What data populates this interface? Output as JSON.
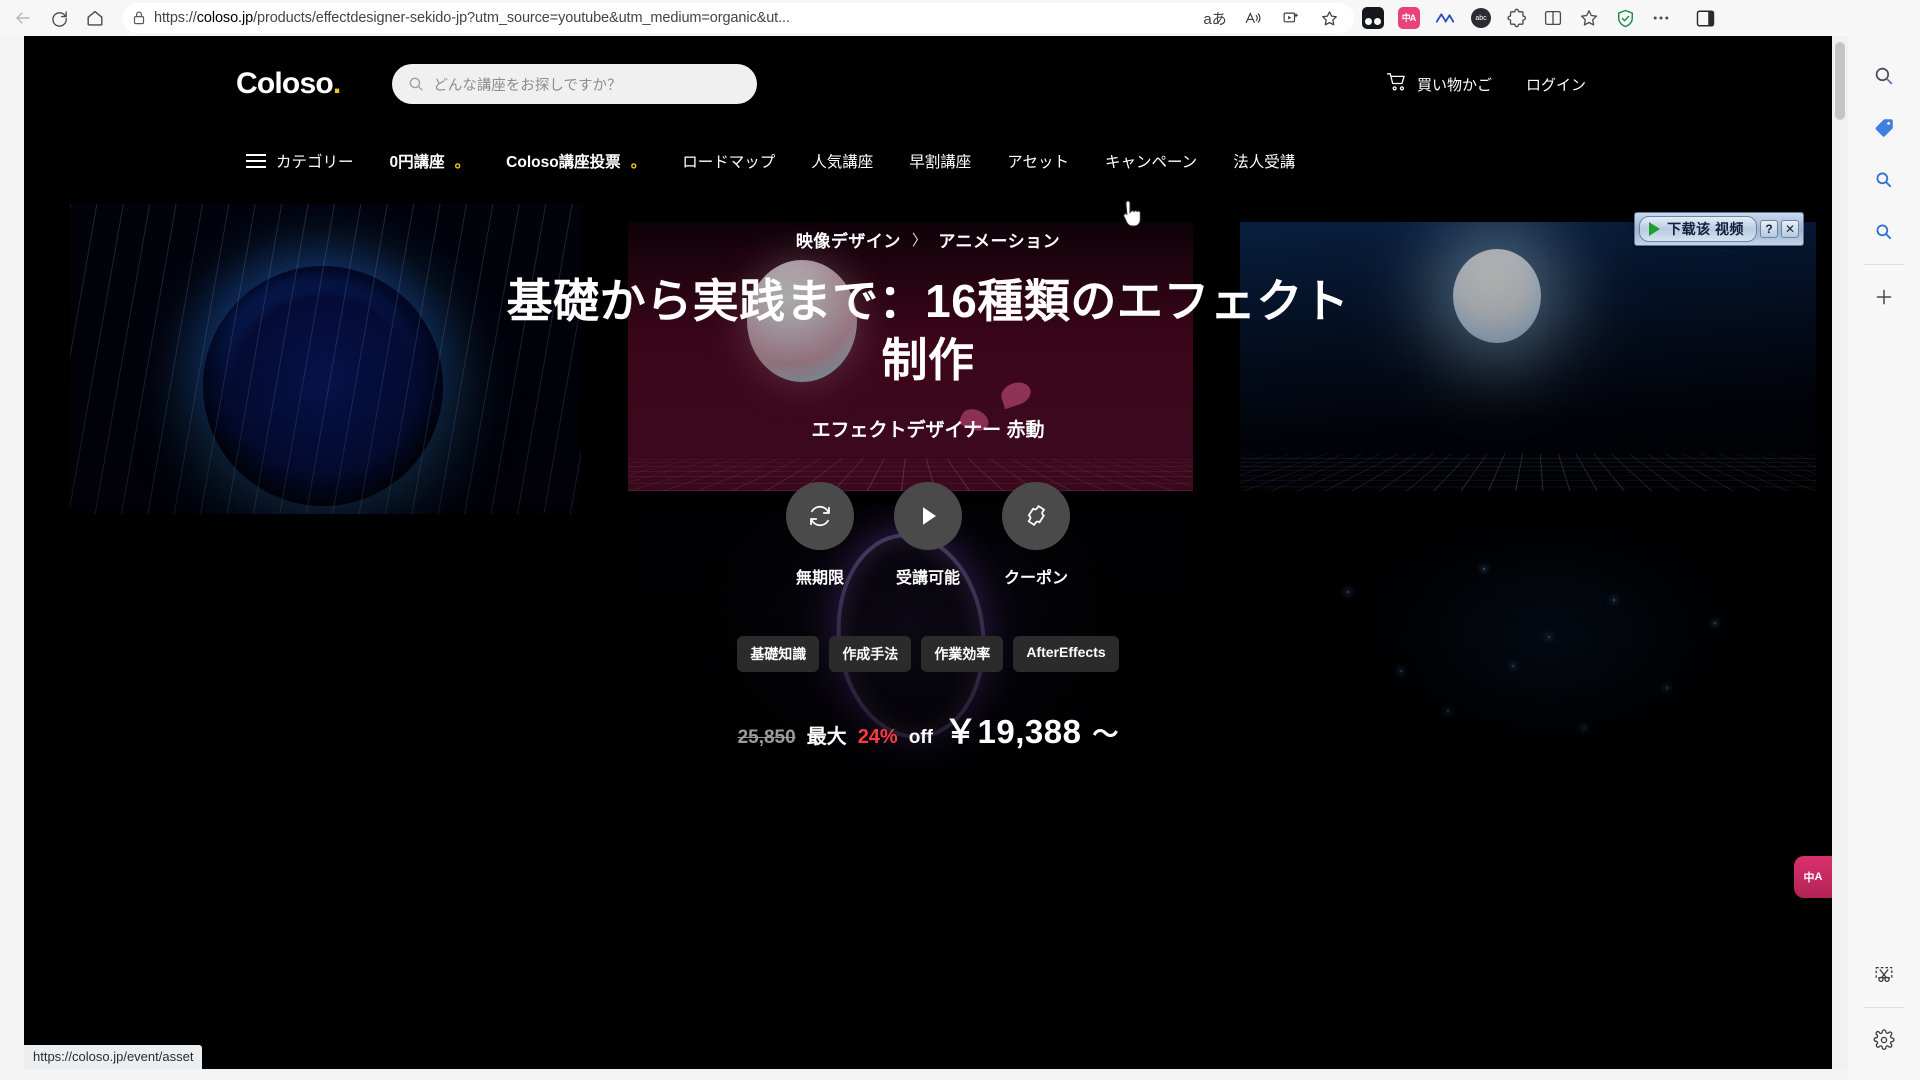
{
  "browser": {
    "back_label": "Back",
    "refresh_label": "Refresh",
    "home_label": "Home",
    "url_host": "coloso.jp",
    "url_prefix": "https://",
    "url_rest": "/products/effectdesigner-sekido-jp?utm_source=youtube&utm_medium=organic&ut...",
    "reading_icon": "aあ",
    "read_aloud_icon": "read-aloud",
    "split_icon": "split-screen",
    "favorite_icon": "star",
    "extensions": [
      {
        "name": "immersive-reader-extension",
        "label": ""
      },
      {
        "name": "translate-extension",
        "label_cn": "中",
        "label_a": "A"
      },
      {
        "name": "claude-extension",
        "label": ""
      },
      {
        "name": "dark-reader-extension",
        "label": ""
      },
      {
        "name": "puzzle-extension",
        "label": ""
      }
    ],
    "collections_label": "Collections",
    "favorites_label": "Favorites",
    "shield_label": "Tracking prevention",
    "more_label": "Settings and more",
    "split_pane_label": "Split screen",
    "status_url": "https://coloso.jp/event/asset"
  },
  "edge_sidebar": {
    "items": [
      {
        "name": "search-icon-1",
        "label": "Search"
      },
      {
        "name": "shopping-tag-icon",
        "label": "Shopping"
      },
      {
        "name": "search-icon-2",
        "label": "Search"
      },
      {
        "name": "search-icon-3",
        "label": "Search"
      },
      {
        "name": "add-icon",
        "label": "Add"
      },
      {
        "name": "screenshot-icon",
        "label": "Web capture"
      },
      {
        "name": "settings-icon",
        "label": "Settings"
      }
    ]
  },
  "site": {
    "logo_text": "Coloso",
    "logo_dot": ".",
    "logo_dot_color": "#f5c518",
    "search_placeholder": "どんな講座をお探しですか？",
    "cart_label": "買い物かご",
    "login_label": "ログイン",
    "nav": [
      {
        "label": "カテゴリー",
        "bold": false,
        "dot": ""
      },
      {
        "label": "0円講座",
        "bold": true,
        "dot": "。"
      },
      {
        "label": "Coloso講座投票",
        "bold": true,
        "dot": "。"
      },
      {
        "label": "ロードマップ",
        "bold": false,
        "dot": ""
      },
      {
        "label": "人気講座",
        "bold": false,
        "dot": ""
      },
      {
        "label": "早割講座",
        "bold": false,
        "dot": ""
      },
      {
        "label": "アセット",
        "bold": false,
        "dot": ""
      },
      {
        "label": "キャンペーン",
        "bold": false,
        "dot": ""
      },
      {
        "label": "法人受講",
        "bold": false,
        "dot": ""
      }
    ]
  },
  "hero": {
    "breadcrumb_category": "映像デザイン",
    "breadcrumb_sep": "〉",
    "breadcrumb_subcategory": "アニメーション",
    "title": "基礎から実践まで：16種類のエフェクト制作",
    "instructor": "エフェクトデザイナー 赤動",
    "features": [
      {
        "icon": "refresh-icon",
        "label": "無期限"
      },
      {
        "icon": "play-icon",
        "label": "受講可能"
      },
      {
        "icon": "ticket-icon",
        "label": "クーポン"
      }
    ],
    "tags": [
      "基礎知識",
      "作成手法",
      "作業効率",
      "AfterEffects"
    ],
    "price": {
      "original": "25,850",
      "discount_prefix": "最大",
      "discount_percent": "24%",
      "discount_suffix": "off",
      "current": "￥19,388",
      "tilde": "～",
      "discount_color": "#ff3b41"
    }
  },
  "download_helper": {
    "label": "下载该 视频",
    "help_label": "?",
    "close_label": "✕"
  },
  "float_translate": {
    "label_cn": "中",
    "label_a": "A",
    "color": "#d9316e"
  }
}
